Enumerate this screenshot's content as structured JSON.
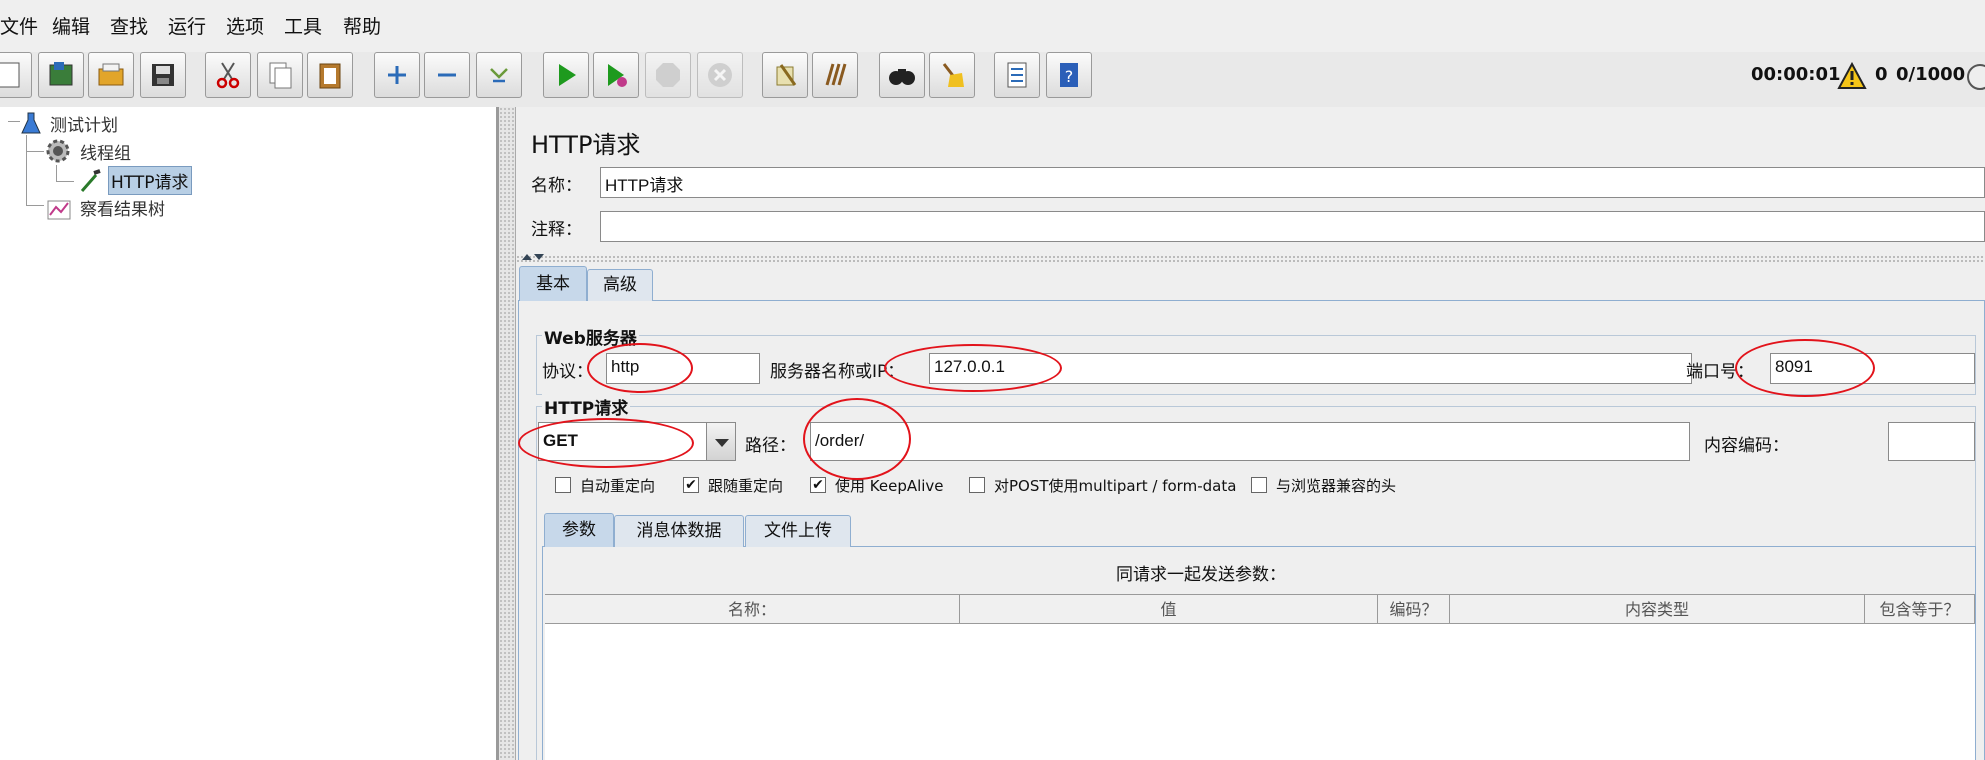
{
  "menu": [
    "文件",
    "编辑",
    "查找",
    "运行",
    "选项",
    "工具",
    "帮助"
  ],
  "toolbar_icons": [
    "new-file-icon",
    "templates-icon",
    "open-icon",
    "save-icon",
    "cut-icon",
    "copy-icon",
    "paste-icon",
    "expand-icon",
    "collapse-icon",
    "toggle-icon",
    "start-icon",
    "start-no-pause-icon",
    "stop-icon",
    "shutdown-icon",
    "clear-icon",
    "clear-all-icon",
    "search-icon",
    "reset-search-icon",
    "function-helper-icon",
    "help-icon"
  ],
  "status": {
    "timer": "00:00:01",
    "warnings": "0",
    "threads": "0/1000"
  },
  "tree": {
    "items": [
      {
        "label": "测试计划"
      },
      {
        "label": "线程组"
      },
      {
        "label": "HTTP请求"
      },
      {
        "label": "察看结果树"
      }
    ]
  },
  "panel": {
    "title": "HTTP请求",
    "name_label": "名称：",
    "name_value": "HTTP请求",
    "comment_label": "注释：",
    "comment_value": "",
    "tabs": [
      "基本",
      "高级"
    ],
    "web_server": {
      "title": "Web服务器",
      "protocol_label": "协议：",
      "protocol_value": "http",
      "server_label": "服务器名称或IP：",
      "server_value": "127.0.0.1",
      "port_label": "端口号：",
      "port_value": "8091"
    },
    "http_request": {
      "title": "HTTP请求",
      "method_value": "GET",
      "path_label": "路径：",
      "path_value": "/order/",
      "encoding_label": "内容编码：",
      "encoding_value": ""
    },
    "checkboxes": [
      {
        "label": "自动重定向",
        "checked": false
      },
      {
        "label": "跟随重定向",
        "checked": true
      },
      {
        "label": "使用 KeepAlive",
        "checked": true
      },
      {
        "label": "对POST使用multipart / form-data",
        "checked": false
      },
      {
        "label": "与浏览器兼容的头",
        "checked": false
      }
    ],
    "subtabs": [
      "参数",
      "消息体数据",
      "文件上传"
    ],
    "params": {
      "title": "同请求一起发送参数：",
      "columns": [
        "名称：",
        "值",
        "编码？",
        "内容类型",
        "包含等于？"
      ]
    }
  },
  "colors": {
    "annotation": "#e2131b",
    "selection": "#b8cfe5"
  }
}
